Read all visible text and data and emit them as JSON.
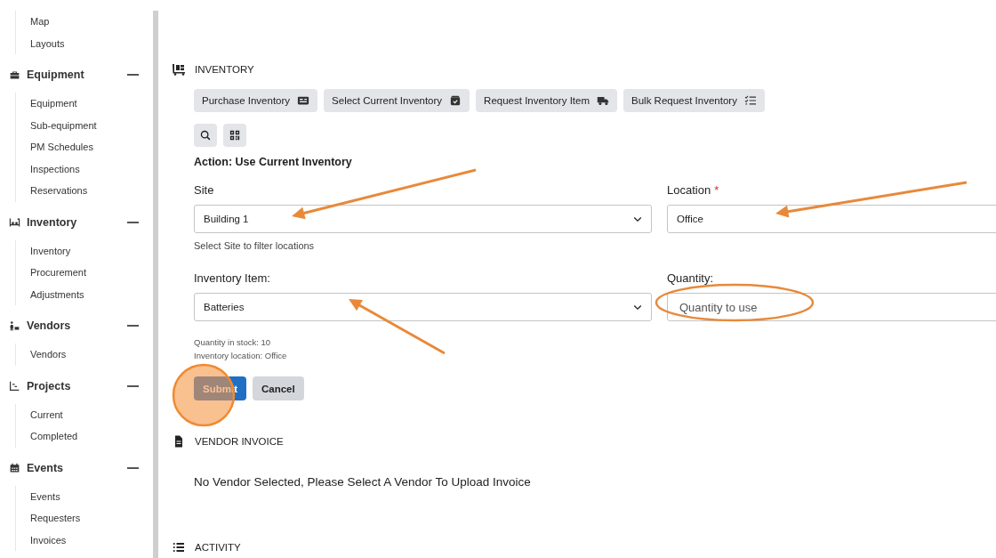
{
  "sidebar": {
    "top_items": [
      "Map",
      "Layouts"
    ],
    "groups": [
      {
        "title": "Equipment",
        "kind": "equipment",
        "expanded": true,
        "items": [
          "Equipment",
          "Sub-equipment",
          "PM Schedules",
          "Inspections",
          "Reservations"
        ]
      },
      {
        "title": "Inventory",
        "kind": "inventory",
        "expanded": true,
        "items": [
          "Inventory",
          "Procurement",
          "Adjustments"
        ]
      },
      {
        "title": "Vendors",
        "kind": "vendors",
        "expanded": true,
        "items": [
          "Vendors"
        ]
      },
      {
        "title": "Projects",
        "kind": "projects",
        "expanded": true,
        "items": [
          "Current",
          "Completed"
        ]
      },
      {
        "title": "Events",
        "kind": "events",
        "expanded": true,
        "items": [
          "Events",
          "Requesters",
          "Invoices"
        ]
      }
    ]
  },
  "inventory": {
    "title": "INVENTORY",
    "action_buttons": [
      {
        "label": "Purchase Inventory",
        "kind": "card"
      },
      {
        "label": "Select Current Inventory",
        "kind": "box"
      },
      {
        "label": "Request Inventory Item",
        "kind": "truck"
      },
      {
        "label": "Bulk Request Inventory",
        "kind": "checklist"
      }
    ],
    "tool_buttons": [
      {
        "kind": "search"
      },
      {
        "kind": "qr"
      }
    ],
    "action_title": "Action: Use Current Inventory",
    "site": {
      "label": "Site",
      "value": "Building 1",
      "chevron": true,
      "helper": "Select Site to filter locations"
    },
    "location": {
      "label": "Location",
      "required_mark": "*",
      "value": "Office"
    },
    "item": {
      "label": "Inventory Item:",
      "value": "Batteries",
      "chevron": true
    },
    "quantity": {
      "label": "Quantity:",
      "placeholder": "Quantity to use"
    },
    "stock_lines": [
      "Quantity in stock: 10",
      "Inventory location: Office"
    ],
    "submit": "Submit",
    "cancel": "Cancel"
  },
  "vendor_invoice": {
    "title": "VENDOR INVOICE",
    "message": "No Vendor Selected, Please Select A Vendor To Upload Invoice"
  },
  "activity": {
    "title": "ACTIVITY"
  },
  "annotations": [
    {
      "kind": "arrow"
    },
    {
      "kind": "arrow"
    },
    {
      "kind": "arrow"
    },
    {
      "kind": "ellipse"
    },
    {
      "kind": "click"
    }
  ]
}
